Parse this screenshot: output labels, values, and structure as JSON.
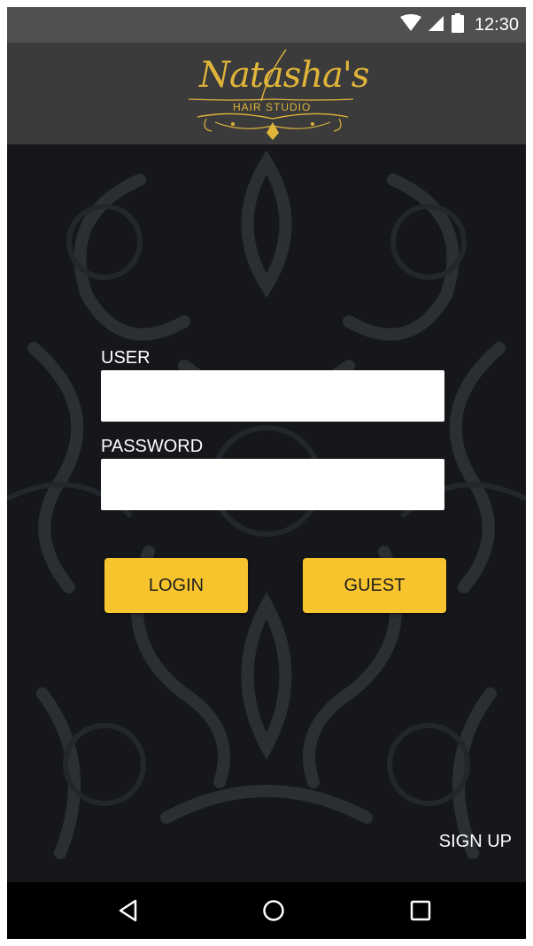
{
  "status_bar": {
    "time": "12:30",
    "icons": [
      "wifi-icon",
      "cell-signal-icon",
      "battery-icon"
    ]
  },
  "header": {
    "logo_script": "Natasha's",
    "logo_subtitle": "HAIR STUDIO",
    "logo_color": "#e0b43a"
  },
  "login_form": {
    "user_label": "USER",
    "user_value": "",
    "password_label": "PASSWORD",
    "password_value": "",
    "login_label": "LOGIN",
    "guest_label": "GUEST"
  },
  "signup_label": "SIGN UP",
  "nav_bar": {
    "icons": [
      "back-icon",
      "home-icon",
      "recents-icon"
    ]
  },
  "colors": {
    "accent": "#f8c42e",
    "header_bg": "#3b3b3b",
    "status_bg": "#505050",
    "main_bg": "#15171b"
  }
}
